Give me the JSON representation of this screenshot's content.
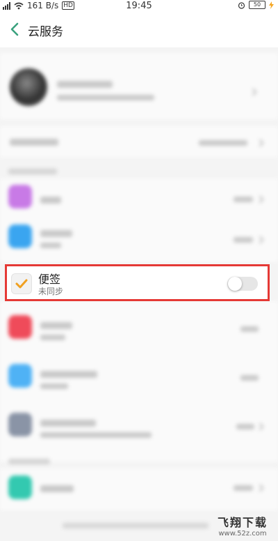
{
  "status_bar": {
    "network_speed": "161 B/s",
    "time": "19:45",
    "battery": "50"
  },
  "header": {
    "title": "云服务",
    "back_icon": "chevron-left-icon",
    "accent_color": "#3aa17e"
  },
  "highlighted_item": {
    "title": "便签",
    "status": "未同步",
    "toggle_on": false,
    "icon": "note-check-icon",
    "icon_color": "#f0a020",
    "highlight_color": "#e53935"
  },
  "watermark": {
    "main": "飞翔下载",
    "sub": "www.52z.com"
  }
}
